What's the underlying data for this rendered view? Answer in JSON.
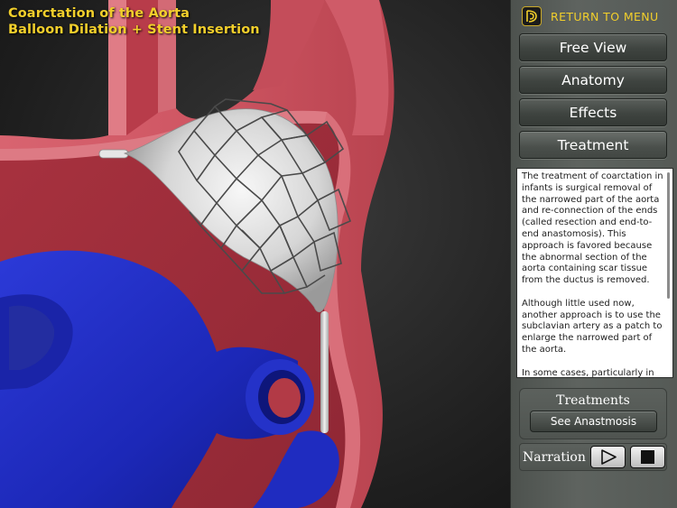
{
  "viewer": {
    "title_line1": "Coarctation of the Aorta",
    "title_line2": "Balloon Dilation + Stent Insertion",
    "scene": "aorta-cross-section-with-balloon-stent"
  },
  "menu": {
    "return_label": "RETURN TO MENU",
    "logo_icon": "app-logo-icon"
  },
  "nav": {
    "free_view": "Free View",
    "anatomy": "Anatomy",
    "effects": "Effects",
    "treatment": "Treatment",
    "active": "treatment"
  },
  "info": {
    "paragraphs": [
      "The treatment of coarctation in infants is surgical removal of the narrowed part of the aorta and re-connection of the ends (called resection and end-to-end anastomosis). This approach is favored because the abnormal section of the aorta containing scar tissue from the ductus is removed.",
      "Although little used now, another approach is to use the subclavian artery as a patch to enlarge the narrowed part of the aorta.",
      "In some cases, particularly in older patients, coarctation of the aorta can be treated by balloon"
    ]
  },
  "treatments": {
    "title": "Treatments",
    "button_label": "See Anastmosis"
  },
  "narration": {
    "label": "Narration",
    "play_icon": "play-icon",
    "stop_icon": "stop-icon"
  },
  "colors": {
    "title_yellow": "#f2cf2b",
    "artery_red": "#c8505a",
    "artery_inner": "#b23a46",
    "vein_blue": "#1e2ec0",
    "panel_gray": "#555a56"
  }
}
